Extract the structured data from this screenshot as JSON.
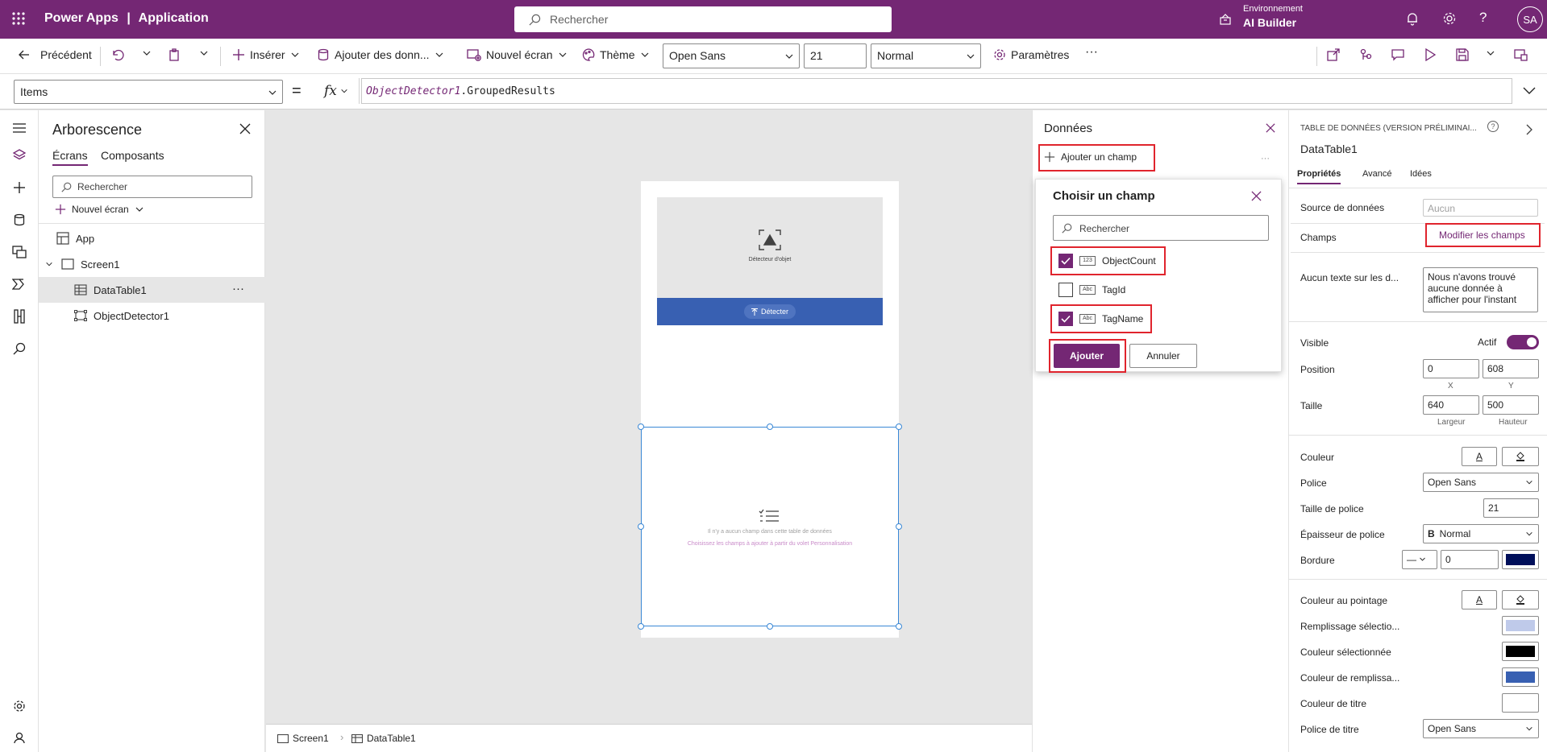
{
  "topbar": {
    "brand": "Power Apps",
    "separator": "|",
    "app": "Application",
    "search_placeholder": "Rechercher",
    "env_label": "Environnement",
    "env_value": "AI Builder",
    "avatar": "SA"
  },
  "commandbar": {
    "back": "Précédent",
    "insert": "Insérer",
    "add_data": "Ajouter des donn...",
    "new_screen": "Nouvel écran",
    "theme": "Thème",
    "font": "Open Sans",
    "font_size": "21",
    "weight": "Normal",
    "settings": "Paramètres",
    "more": "···"
  },
  "formula": {
    "property": "Items",
    "equals": "=",
    "fx": "fx",
    "expr_obj": "ObjectDetector1",
    "expr_rest": ".GroupedResults"
  },
  "tree": {
    "title": "Arborescence",
    "tabs": [
      "Écrans",
      "Composants"
    ],
    "search_placeholder": "Rechercher",
    "new_screen": "Nouvel écran",
    "items": [
      "App",
      "Screen1",
      "DataTable1",
      "ObjectDetector1"
    ],
    "more": "···"
  },
  "canvas": {
    "detector_label": "Détecteur d'objet",
    "detect_button": "Détecter",
    "empty_line1": "Il n'y a aucun champ dans cette table de données",
    "empty_line2": "Choisissez les champs à ajouter à partir du volet Personnalisation"
  },
  "bottom": {
    "crumbs": [
      "Screen1",
      "DataTable1"
    ]
  },
  "data_panel": {
    "title": "Données",
    "add_field": "Ajouter un champ",
    "more": "···",
    "choose_title": "Choisir un champ",
    "search_placeholder": "Rechercher",
    "fields": [
      {
        "name": "ObjectCount",
        "type": "123",
        "checked": true
      },
      {
        "name": "TagId",
        "type": "Abc",
        "checked": false
      },
      {
        "name": "TagName",
        "type": "Abc",
        "checked": true
      }
    ],
    "add": "Ajouter",
    "cancel": "Annuler"
  },
  "props": {
    "type_label": "TABLE DE DONNÉES (VERSION PRÉLIMINAI...",
    "name": "DataTable1",
    "tabs": [
      "Propriétés",
      "Avancé",
      "Idées"
    ],
    "source_label": "Source de données",
    "source_value": "Aucun",
    "fields_label": "Champs",
    "fields_link": "Modifier les champs",
    "notext_label": "Aucun texte sur les d...",
    "notext_value": "Nous n'avons trouvé aucune donnée à afficher pour l'instant",
    "visible_label": "Visible",
    "visible_value": "Actif",
    "position_label": "Position",
    "pos_x": "0",
    "pos_y": "608",
    "x_lbl": "X",
    "y_lbl": "Y",
    "size_label": "Taille",
    "width": "640",
    "height": "500",
    "w_lbl": "Largeur",
    "h_lbl": "Hauteur",
    "color_label": "Couleur",
    "font_label": "Police",
    "font_value": "Open Sans",
    "fontsize_label": "Taille de police",
    "fontsize_value": "21",
    "weight_label": "Épaisseur de police",
    "weight_value": "Normal",
    "border_label": "Bordure",
    "border_value": "0",
    "hover_label": "Couleur au pointage",
    "selfill_label": "Remplissage sélectio...",
    "selcolor_label": "Couleur sélectionnée",
    "fillcolor_label": "Couleur de remplissa...",
    "titlecolor_label": "Couleur de titre",
    "titlefont_label": "Police de titre",
    "titlefont_value": "Open Sans",
    "colors": {
      "accent": "#742774",
      "border": "#000f5a",
      "fill": "#3860b2"
    }
  }
}
